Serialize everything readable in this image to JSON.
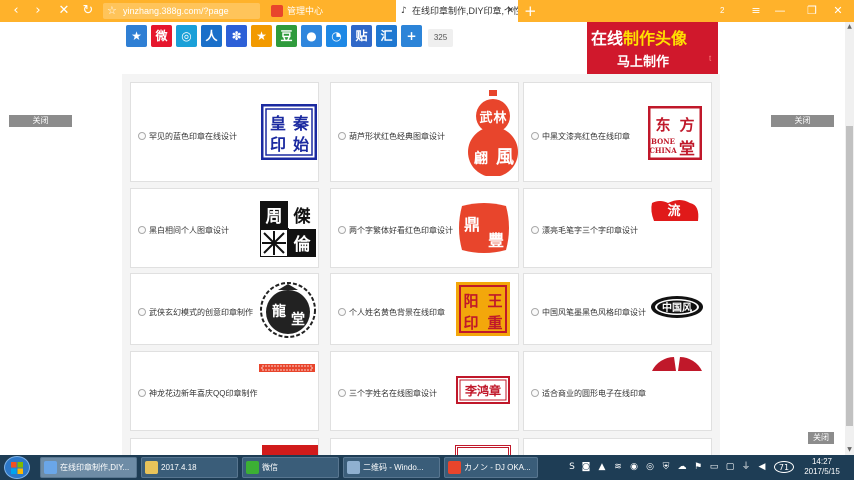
{
  "browser": {
    "address": "yinzhang.388g.com/?page",
    "tab1_label": "管理中心",
    "tab2_label": "在线印章制作,DIY印章,个性",
    "new_tab": "+",
    "tab_count": "2",
    "nav": {
      "back": "‹",
      "forward": "›",
      "close": "✕",
      "refresh": "↻"
    },
    "window_controls": {
      "min": "—",
      "max": "❐",
      "close": "✕"
    }
  },
  "page": {
    "close_left": "关闭",
    "close_right": "关闭",
    "close_bottom": "关闭",
    "share_count": "325",
    "share_icons": [
      {
        "name": "qzone",
        "glyph": "★",
        "color": "#2f7fd4"
      },
      {
        "name": "weibo",
        "glyph": "微",
        "color": "#e6162d"
      },
      {
        "name": "tqq",
        "glyph": "◎",
        "color": "#1aa0d8"
      },
      {
        "name": "renren",
        "glyph": "人",
        "color": "#1a6fc9"
      },
      {
        "name": "baidu",
        "glyph": "✽",
        "color": "#2d60d7"
      },
      {
        "name": "star",
        "glyph": "★",
        "color": "#f29a00"
      },
      {
        "name": "douban",
        "glyph": "豆",
        "color": "#2f9b3c"
      },
      {
        "name": "kaixin",
        "glyph": "●",
        "color": "#2f86dd"
      },
      {
        "name": "qq",
        "glyph": "◔",
        "color": "#1e88e5"
      },
      {
        "name": "tieba",
        "glyph": "贴",
        "color": "#3068c8"
      },
      {
        "name": "huiz",
        "glyph": "汇",
        "color": "#1f78d1"
      },
      {
        "name": "more",
        "glyph": "+",
        "color": "#2c84d8"
      }
    ],
    "banner": {
      "line1_white": "在线",
      "line1_yellow": "制作头像",
      "line2": "马上制作",
      "line3": "t"
    },
    "cards": [
      {
        "label": "罕见的蓝色印章在线设计",
        "seal": [
          "皇",
          "秦",
          "印",
          "始"
        ]
      },
      {
        "label": "葫芦形状红色经典图章设计",
        "seal": [
          "武",
          "林",
          "風",
          "翩"
        ]
      },
      {
        "label": "中黑文漆亮红色在线印章",
        "seal": [
          "东",
          "方",
          "BONE CHINA",
          "堂"
        ]
      },
      {
        "label": "黑白相间个人图章设计",
        "seal": [
          "周",
          "傑",
          "倫"
        ]
      },
      {
        "label": "两个字繁体好看红色印章设计",
        "seal": [
          "鼎",
          "豐"
        ]
      },
      {
        "label": "漂亮毛笔字三个字印章设计",
        "seal": [
          "流"
        ]
      },
      {
        "label": "武侠玄幻模式的创意印章制作",
        "seal": [
          "龍",
          "堂"
        ]
      },
      {
        "label": "个人姓名黄色背景在线印章",
        "seal": [
          "王",
          "阳",
          "重",
          "印"
        ]
      },
      {
        "label": "中国风笔墨黑色风格印章设计",
        "seal": [
          "中国风"
        ]
      },
      {
        "label": "神龙花边新年喜庆QQ印章制作",
        "seal": []
      },
      {
        "label": "三个字姓名在线图章设计",
        "seal": [
          "李鸿章"
        ]
      },
      {
        "label": "适合商业的圆形电子在线印章",
        "seal": []
      }
    ]
  },
  "taskbar": {
    "tasks": [
      {
        "label": "在线印章制作,DIY...",
        "icon_color": "#6aa6e8"
      },
      {
        "label": "2017.4.18",
        "icon_color": "#e8c35a"
      },
      {
        "label": "微信",
        "icon_color": "#3cb034"
      },
      {
        "label": "二维码 - Windo...",
        "icon_color": "#8fb0d0"
      },
      {
        "label": "カノン - DJ OKA...",
        "icon_color": "#e8452c"
      }
    ],
    "time": "14:27",
    "date": "2017/5/15",
    "badge": "71"
  }
}
